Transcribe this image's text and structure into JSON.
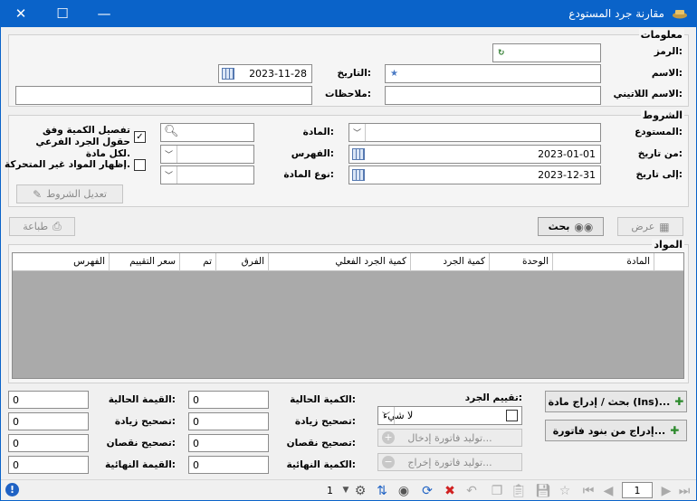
{
  "window": {
    "title": "مقارنة جرد المستودع",
    "close": "✕",
    "maximize": "☐",
    "minimize": "—"
  },
  "info": {
    "title": "معلومات",
    "code_label": "الرمز:",
    "code_value": "",
    "name_label": "الاسم:",
    "name_value": "",
    "latin_label": "الاسم اللاتيني:",
    "latin_value": "",
    "date_label": "التاريخ:",
    "date_value": "2023-11-28",
    "notes_label": "ملاحظات:",
    "notes_value": ""
  },
  "conditions": {
    "title": "الشروط",
    "warehouse_label": "المستودع:",
    "warehouse_value": "",
    "from_label": "من تاريخ:",
    "from_value": "2023-01-01",
    "to_label": "إلى تاريخ:",
    "to_value": "2023-12-31",
    "material_label": "المادة:",
    "material_value": "",
    "index_label": "الفهرس:",
    "index_value": "",
    "type_label": "نوع المادة:",
    "type_value": "",
    "detail_label": "تفصيل الكمية وفق حقول الجرد الفرعي لكل مادة.",
    "detail_checked": true,
    "show_label": "إظهار المواد غير المتحركة.",
    "show_checked": false,
    "edit_label": "تعديل الشروط"
  },
  "actions": {
    "view_label": "عرض",
    "search_label": "بحث",
    "print_label": "طباعة"
  },
  "materials": {
    "title": "المواد",
    "columns": [
      "المادة",
      "الوحدة",
      "كمية الجرد",
      "كمية الجرد الفعلي",
      "الفرق",
      "تم",
      "سعر التقييم",
      "الفهرس"
    ]
  },
  "bottom": {
    "search_insert_label": "بحث / إدراج مادة (Ins)...",
    "insert_invoice_label": "إدراج من بنود فاتورة...",
    "valuation_label": "تقييم الجرد:",
    "valuation_value": "لا شيء",
    "gen_in_label": "توليد فاتورة إدخال...",
    "gen_out_label": "توليد فاتورة إخراج...",
    "current_qty_label": "الكمية الحالية:",
    "current_qty_value": "0",
    "inc_qty_label": "تصحيح زيادة:",
    "inc_qty_value": "0",
    "dec_qty_label": "تصحيح نقصان:",
    "dec_qty_value": "0",
    "final_qty_label": "الكمية النهائية:",
    "final_qty_value": "0",
    "current_val_label": "القيمة الحالية:",
    "current_val_value": "0",
    "inc_val_label": "تصحيح زيادة:",
    "inc_val_value": "0",
    "dec_val_label": "تصحيح نقصان:",
    "dec_val_value": "0",
    "final_val_label": "القيمة النهائية:",
    "final_val_value": "0"
  },
  "statusbar": {
    "page_value": "1",
    "count_value": "1"
  },
  "colors": {
    "titlebar": "#0a63c9",
    "grid_bg": "#aaaaaa"
  }
}
